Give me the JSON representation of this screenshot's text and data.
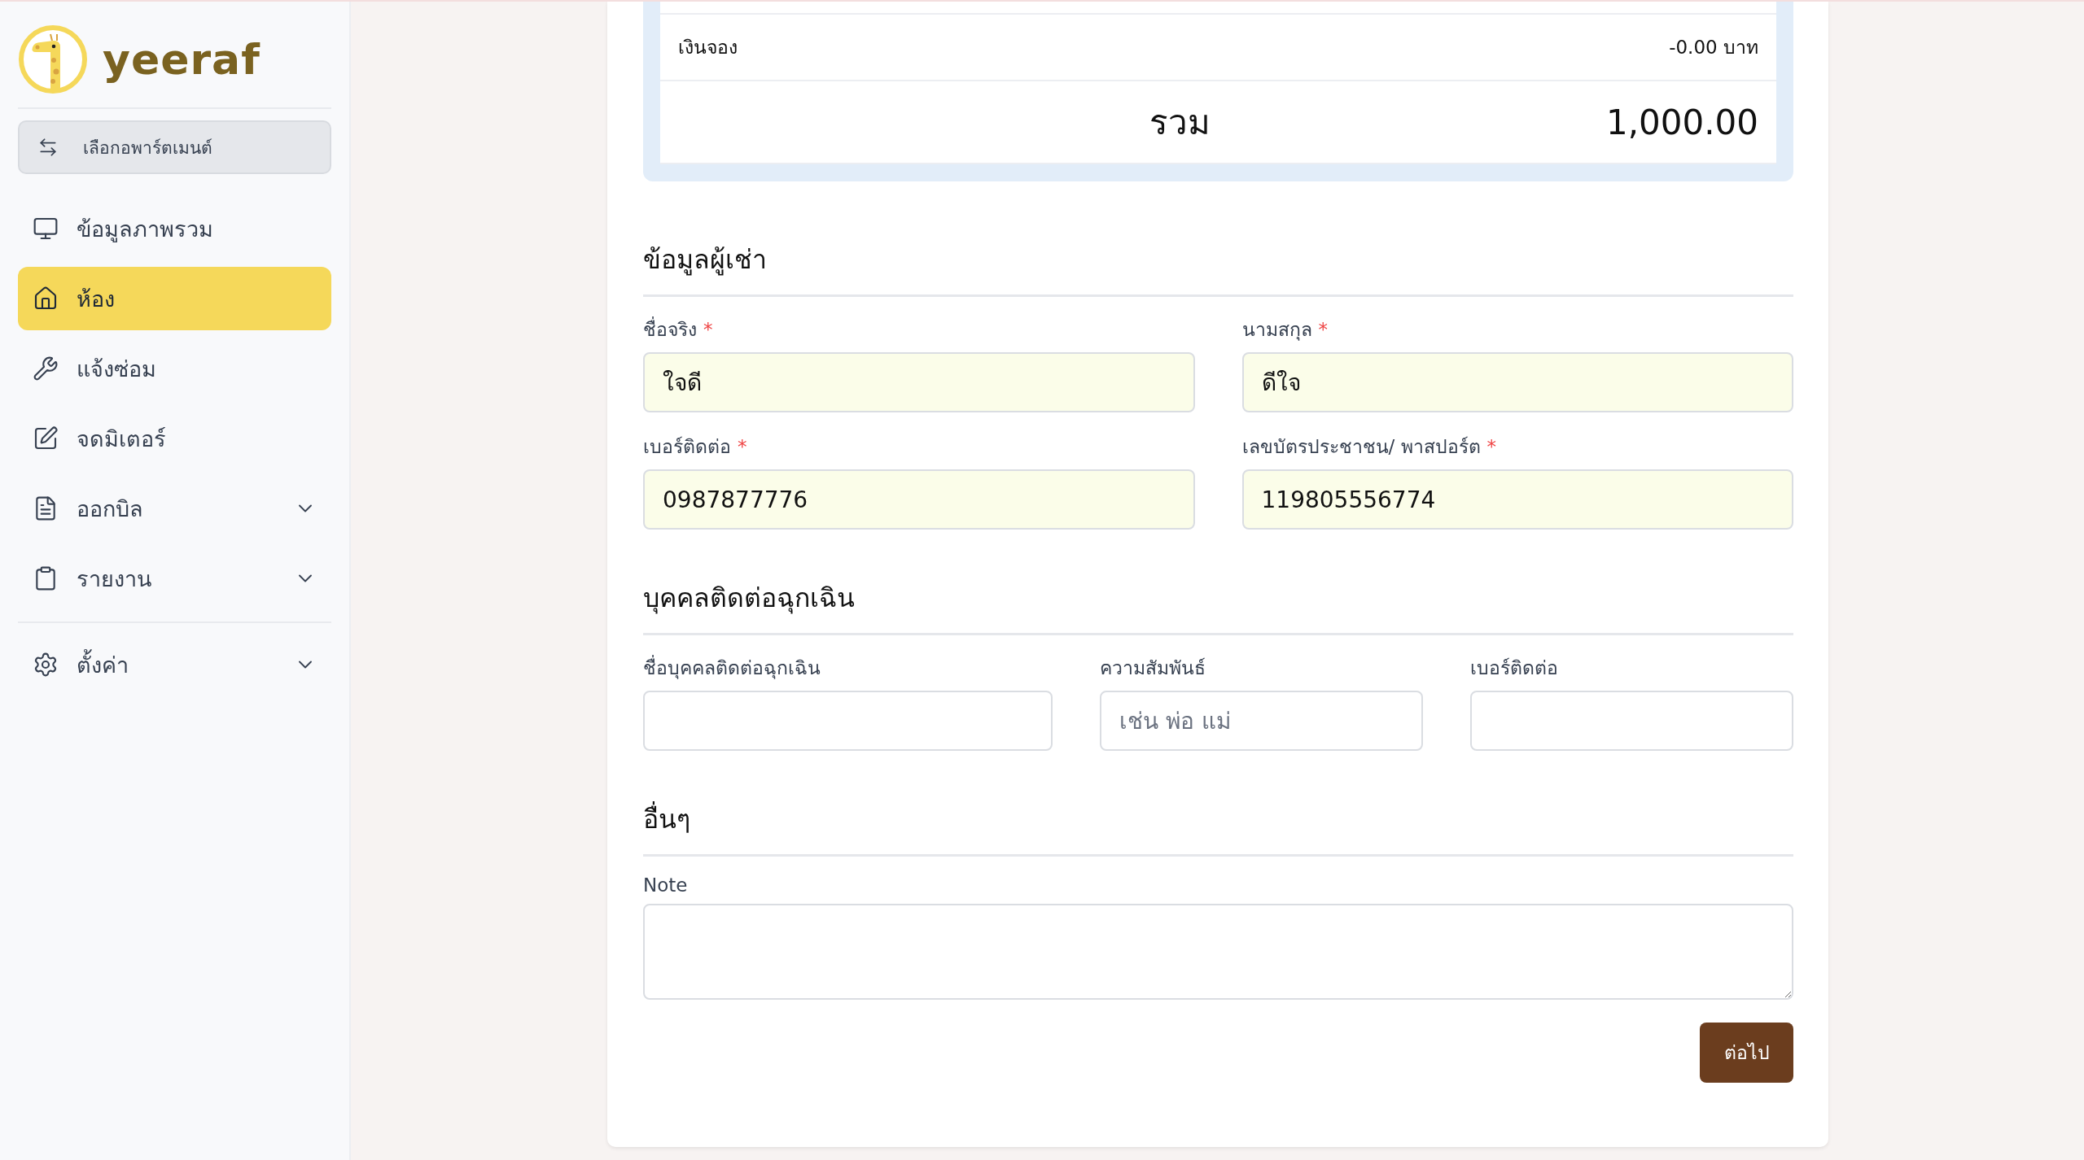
{
  "brand": {
    "name": "yeeraf"
  },
  "apartment_button": {
    "label": "เลือกอพาร์ตเมนต์"
  },
  "sidebar": {
    "items": [
      {
        "label": "ข้อมูลภาพรวม",
        "kind": "monitor",
        "selected": false,
        "has_submenu": false
      },
      {
        "label": "ห้อง",
        "kind": "home",
        "selected": true,
        "has_submenu": false
      },
      {
        "label": "แจ้งซ่อม",
        "kind": "wrench",
        "selected": false,
        "has_submenu": false
      },
      {
        "label": "จดมิเตอร์",
        "kind": "edit",
        "selected": false,
        "has_submenu": false
      },
      {
        "label": "ออกบิล",
        "kind": "file",
        "selected": false,
        "has_submenu": true
      },
      {
        "label": "รายงาน",
        "kind": "clipboard",
        "selected": false,
        "has_submenu": true
      }
    ],
    "footer_items": [
      {
        "label": "ตั้งค่า",
        "kind": "gear",
        "selected": false,
        "has_submenu": true
      }
    ]
  },
  "summary": {
    "rows": [
      {
        "label": "เงินจอง",
        "value": "-0.00 บาท"
      }
    ],
    "total": {
      "label": "รวม",
      "value": "1,000.00"
    }
  },
  "sections": [
    {
      "title": "ข้อมูลผู้เช่า",
      "fields": [
        {
          "label": "ชื่อจริง",
          "required_mark": "*",
          "kind": "text",
          "value": "ใจดี"
        },
        {
          "label": "นามสกุล",
          "required_mark": "*",
          "kind": "text",
          "value": "ดีใจ"
        },
        {
          "label": "เบอร์ติดต่อ",
          "required_mark": "*",
          "kind": "text",
          "value": "0987877776"
        },
        {
          "label": "เลขบัตรประชาชน/ พาสปอร์ต",
          "required_mark": "*",
          "kind": "text",
          "value": "119805556774"
        }
      ]
    },
    {
      "title": "บุคคลติดต่อฉุกเฉิน",
      "fields": [
        {
          "label": "ชื่อบุคคลติดต่อฉุกเฉิน",
          "kind": "text"
        },
        {
          "label": "ความสัมพันธ์",
          "kind": "text",
          "placeholder": "เช่น พ่อ แม่"
        },
        {
          "label": "เบอร์ติดต่อ",
          "kind": "text"
        }
      ]
    },
    {
      "title": "อื่นๆ",
      "fields": [
        {
          "label": "Note",
          "kind": "textarea"
        }
      ]
    }
  ],
  "next_button": {
    "label": "ต่อไป"
  }
}
